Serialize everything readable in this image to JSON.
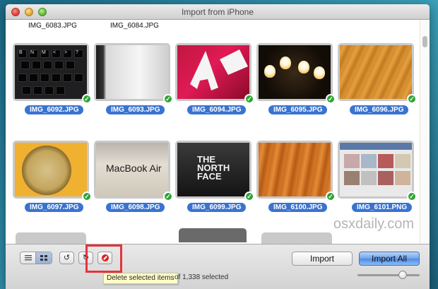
{
  "window": {
    "title": "Import from iPhone"
  },
  "partial_row": [
    "IMG_6083.JPG",
    "IMG_6084.JPG"
  ],
  "photos": [
    {
      "name": "IMG_6092.JPG",
      "selected": true,
      "image": "keyboard"
    },
    {
      "name": "IMG_6093.JPG",
      "selected": true,
      "image": "macbook-lid"
    },
    {
      "name": "IMG_6094.JPG",
      "selected": true,
      "image": "red-sign"
    },
    {
      "name": "IMG_6095.JPG",
      "selected": true,
      "image": "lamp"
    },
    {
      "name": "IMG_6096.JPG",
      "selected": true,
      "image": "wood"
    },
    {
      "name": "IMG_6097.JPG",
      "selected": true,
      "image": "coin"
    },
    {
      "name": "IMG_6098.JPG",
      "selected": true,
      "image": "macbook-air-box"
    },
    {
      "name": "IMG_6099.JPG",
      "selected": true,
      "image": "north-face"
    },
    {
      "name": "IMG_6100.JPG",
      "selected": true,
      "image": "wood-floor"
    },
    {
      "name": "IMG_6101.PNG",
      "selected": true,
      "image": "screenshot"
    }
  ],
  "keyboard_keys": [
    "B",
    "N",
    "M",
    "<",
    ">",
    "?",
    "",
    ""
  ],
  "macbook_box_text": "MacBook Air",
  "north_face_text": [
    "THE",
    "NORTH",
    "FACE"
  ],
  "watermark": "osxdaily.com",
  "toolbar": {
    "view_list_icon": "list-icon",
    "view_grid_icon": "grid-icon",
    "rotate_left_glyph": "↺",
    "rotate_right_glyph": "↻",
    "tooltip": "Delete selected items",
    "status": "of 1,338 selected",
    "import_label": "Import",
    "import_all_label": "Import All",
    "thumbnail_size_fraction": 0.65
  },
  "colors": {
    "selection_blue": "#3a73d0",
    "check_green": "#2fa334",
    "highlight_red": "#e5343c"
  }
}
